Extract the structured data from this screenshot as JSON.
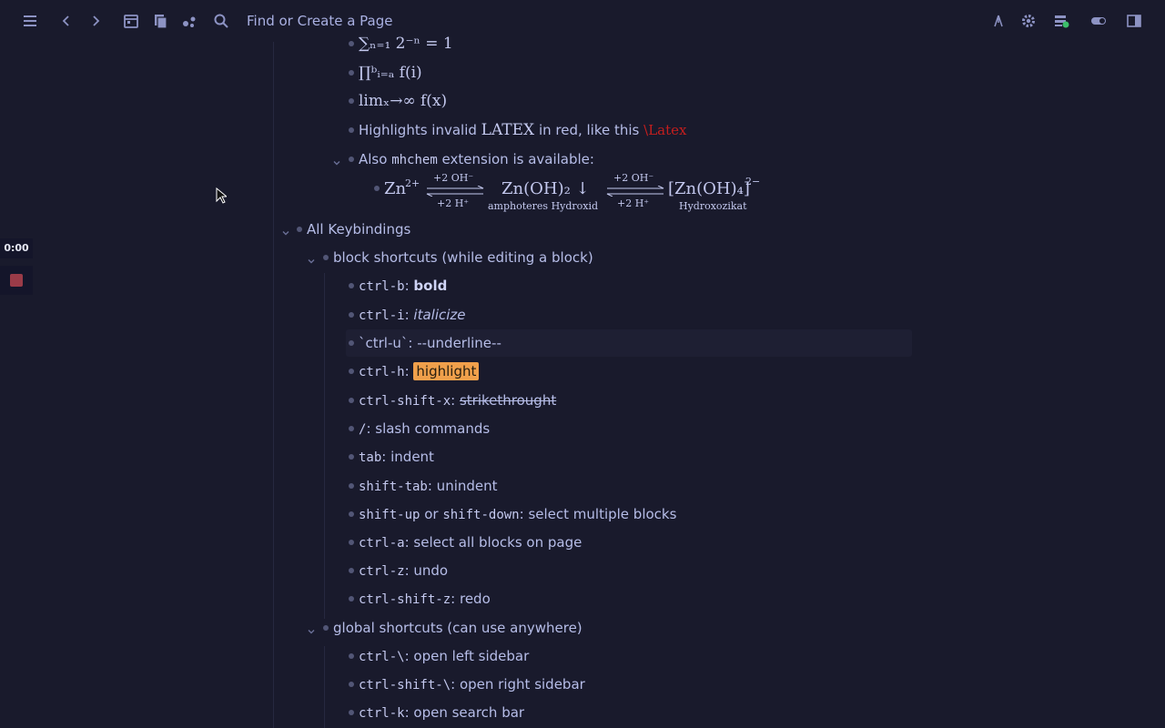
{
  "header": {
    "search_label": "Find or Create a Page",
    "icons": [
      "menu-icon",
      "back-icon",
      "forward-icon",
      "calendar-icon",
      "pages-icon",
      "graph-icon",
      "search-icon",
      "git-icon",
      "settings-icon",
      "sync-icon",
      "toggle-icon",
      "sidebar-icon"
    ]
  },
  "recorder": {
    "time": "0:00"
  },
  "math": {
    "sum": "∑ₙ₌₁ 2⁻ⁿ = 1",
    "prod": "∏ᵇᵢ₌ₐ f(i)",
    "lim": "limₓ→∞ f(x)",
    "latex_prefix": "Highlights invalid ",
    "latex_logo": "LATEX",
    "latex_mid": " in red, like this ",
    "latex_invalid": "\\Latex",
    "mhchem_prefix": "Also ",
    "mhchem_code": "mhchem",
    "mhchem_suffix": " extension is available:",
    "chem": {
      "zn": "Zn",
      "zn_charge": "2+",
      "arrow1_top": "+2 OH⁻",
      "arrow1_bottom": "+2 H⁺",
      "znoh2": "Zn(OH)₂ ↓",
      "znoh2_label": "amphoteres Hydroxid",
      "arrow2_top": "+2 OH⁻",
      "arrow2_bottom": "+2 H⁺",
      "znoh4": "[Zn(OH)₄]",
      "znoh4_charge": "2−",
      "znoh4_label": "Hydroxozikat"
    }
  },
  "keybindings": {
    "title": "All Keybindings",
    "block_title": "block shortcuts (while editing a block)",
    "block": {
      "b_key": "ctrl-b",
      "b_sep": ": ",
      "b_val": "bold",
      "i_key": "ctrl-i",
      "i_sep": ": ",
      "i_val": "italicize",
      "u_line": "`ctrl-u`: --underline--",
      "h_key": "ctrl-h",
      "h_sep": ": ",
      "h_val": "highlight",
      "x_key": "ctrl-shift-x",
      "x_sep": ": ",
      "x_val": "strikethrought",
      "slash_key": "/",
      "slash_val": ": slash commands",
      "tab_key": "tab",
      "tab_val": ": indent",
      "st_key": "shift-tab",
      "st_val": ": unindent",
      "su_key": "shift-up",
      "su_mid": " or ",
      "sd_key": "shift-down",
      "sd_val": ": select multiple blocks",
      "a_key": "ctrl-a",
      "a_val": ": select all blocks on page",
      "z_key": "ctrl-z",
      "z_val": ": undo",
      "sz_key": "ctrl-shift-z",
      "sz_val": ": redo"
    },
    "global_title": "global shortcuts (can use anywhere)",
    "global": {
      "l_key": "ctrl-\\",
      "l_val": ": open left sidebar",
      "r_key": "ctrl-shift-\\",
      "r_val": ": open right sidebar",
      "k_key": "ctrl-k",
      "k_val": ": open search bar"
    }
  },
  "colors": {
    "background": "#191a2c",
    "text": "#b6bde8",
    "highlight": "#f0a04b",
    "invalid_latex": "#c41e1e"
  }
}
